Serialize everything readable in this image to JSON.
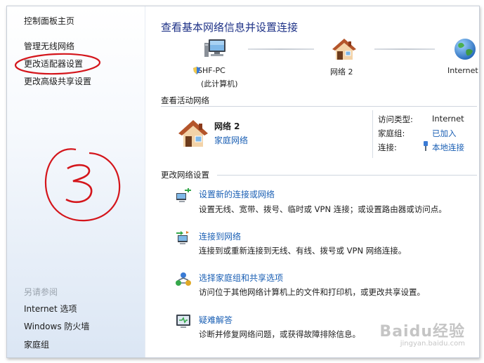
{
  "sidebar": {
    "home": "控制面板主页",
    "items": [
      {
        "label": "管理无线网络"
      },
      {
        "label": "更改适配器设置"
      },
      {
        "label": "更改高级共享设置"
      }
    ],
    "see_also_title": "另请参阅",
    "see_also": [
      {
        "label": "Internet 选项"
      },
      {
        "label": "Windows 防火墙"
      },
      {
        "label": "家庭组"
      }
    ]
  },
  "main": {
    "title": "查看基本网络信息并设置连接",
    "map": {
      "computer": "SHF-PC",
      "computer_sub": "(此计算机)",
      "network": "网络  2",
      "internet": "Internet"
    },
    "active": {
      "heading": "查看活动网络",
      "network_name": "网络  2",
      "network_type": "家庭网络",
      "access_label": "访问类型:",
      "access_value": "Internet",
      "homegroup_label": "家庭组:",
      "homegroup_value": "已加入",
      "connection_label": "连接:",
      "connection_value": "本地连接"
    },
    "change": {
      "heading": "更改网络设置",
      "tasks": [
        {
          "title": "设置新的连接或网络",
          "desc": "设置无线、宽带、拨号、临时或 VPN 连接；或设置路由器或访问点。"
        },
        {
          "title": "连接到网络",
          "desc": "连接到或重新连接到无线、有线、拨号或 VPN 网络连接。"
        },
        {
          "title": "选择家庭组和共享选项",
          "desc": "访问位于其他网络计算机上的文件和打印机，或更改共享设置。"
        },
        {
          "title": "疑难解答",
          "desc": "诊断并修复网络问题，或获得故障排除信息。"
        }
      ]
    }
  },
  "watermark": {
    "main": "Baidu经验",
    "sub": "jingyan.baidu.com"
  },
  "colors": {
    "link": "#1a5fb4",
    "title": "#1e3287",
    "annotation": "#d4151b"
  }
}
